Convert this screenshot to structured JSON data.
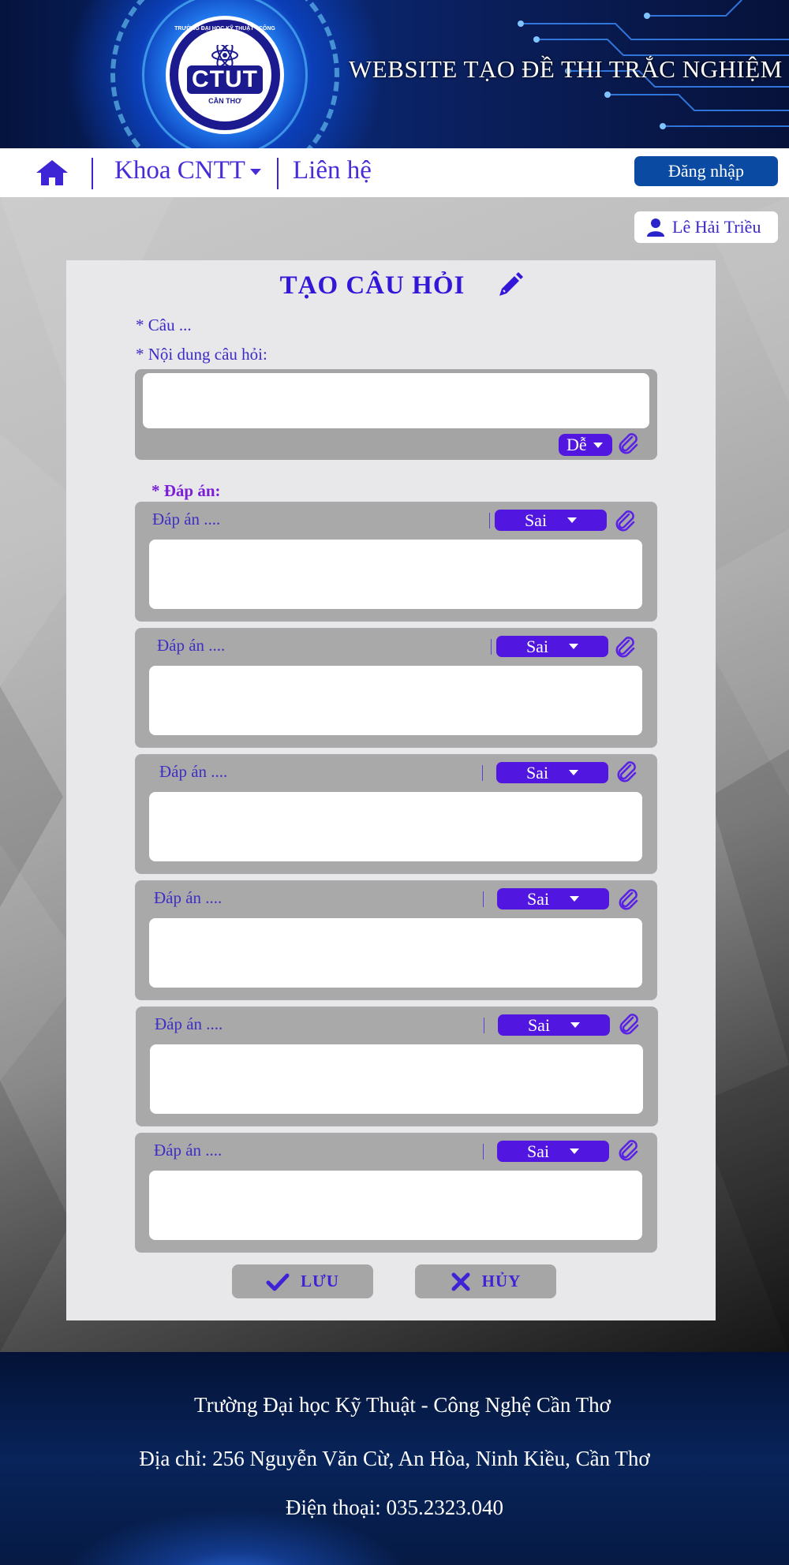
{
  "header": {
    "site_title": "WEBSITE TẠO ĐỀ THI TRẮC NGHIỆM",
    "logo": {
      "abbr": "CTUT",
      "ring_text": "TRƯỜNG ĐẠI HỌC KỸ THUẬT - CÔNG NGHỆ",
      "city": "CẦN THƠ"
    }
  },
  "nav": {
    "home_icon": "home-icon",
    "department": "Khoa CNTT",
    "contact": "Liên hệ",
    "login": "Đăng nhập"
  },
  "user": {
    "name": "Lê Hải Triều",
    "icon": "user-icon"
  },
  "form": {
    "title": "TẠO CÂU HỎI",
    "question_number_label": "* Câu ...",
    "question_content_label": "* Nội dung câu hỏi:",
    "question_value": "",
    "difficulty": "Dễ",
    "answers_heading": "* Đáp án:",
    "answers": [
      {
        "label": "Đáp án ....",
        "correctness": "Sai",
        "value": ""
      },
      {
        "label": "Đáp án ....",
        "correctness": "Sai",
        "value": ""
      },
      {
        "label": "Đáp án ....",
        "correctness": "Sai",
        "value": ""
      },
      {
        "label": "Đáp án ....",
        "correctness": "Sai",
        "value": ""
      },
      {
        "label": "Đáp án ....",
        "correctness": "Sai",
        "value": ""
      },
      {
        "label": "Đáp án ....",
        "correctness": "Sai",
        "value": ""
      }
    ],
    "save_label": "LƯU",
    "cancel_label": "HỦY"
  },
  "footer": {
    "school": "Trường Đại học Kỹ Thuật - Công Nghệ Cần Thơ",
    "address": "Địa chỉ: 256 Nguyễn Văn Cừ, An Hòa, Ninh Kiều, Cần Thơ",
    "phone": "Điện thoại: 035.2323.040"
  },
  "colors": {
    "accent": "#5117e0",
    "text_purple": "#3b2bc6",
    "login_button": "#0a4aa3"
  }
}
